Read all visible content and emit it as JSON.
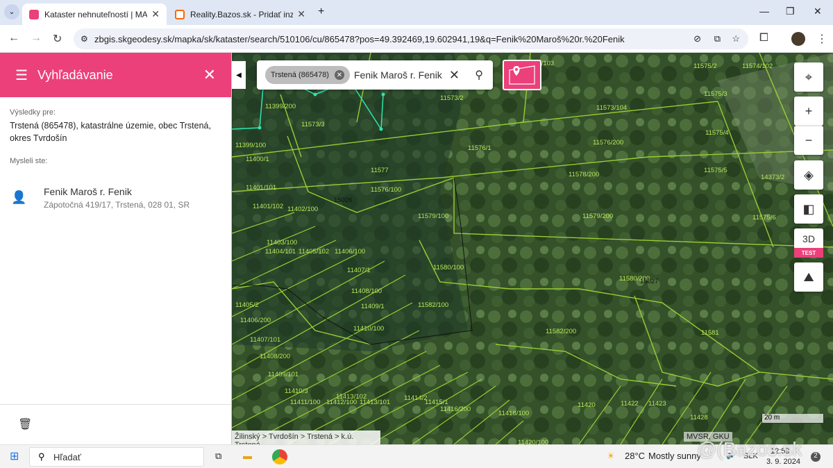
{
  "browser": {
    "tab1_title": "Kataster nehnuteľností | MAPKA",
    "tab2_title": "Reality.Bazos.sk - Pridať inzerát",
    "url": "zbgis.skgeodesy.sk/mapka/sk/kataster/search/510106/cu/865478?pos=49.392469,19.602941,19&q=Fenik%20Maroš%20r.%20Fenik"
  },
  "panel": {
    "title": "Vyhľadávanie",
    "results_for_label": "Výsledky pre:",
    "results_for_value": "Trstená (865478), katastrálne územie, obec Trstená, okres Tvrdošín",
    "did_you_mean_label": "Mysleli ste:",
    "person_name": "Fenik Maroš r. Fenik",
    "person_address": "Zápotočná 419/17, Trstená, 028 01, SR"
  },
  "search": {
    "chip": "Trstená (865478)",
    "query": "Fenik Maroš r. Fenik"
  },
  "map": {
    "control_3d": "3D",
    "badge": "TEST",
    "breadcrumb": "Žilinský > Tvrdošín > Trstená > k.ú. Trstená",
    "scale": "20 m",
    "attribution": "MVSR, GKU",
    "parcels": [
      "11573/103",
      "11575/2",
      "11574/102",
      "11399/200",
      "11573/3",
      "11573/2",
      "11573/104",
      "11575/3",
      "11399/100",
      "11400/1",
      "11576/1",
      "11575/4",
      "11576/200",
      "11577",
      "11576/100",
      "11578/200",
      "11575/5",
      "14373/2",
      "11401/101",
      "15026",
      "11401/102",
      "11402/100",
      "11579/100",
      "11579/200",
      "11575/6",
      "11403/100",
      "11404/101",
      "11405/102",
      "11406/100",
      "11580/100",
      "11580/200",
      "15027",
      "11407/1",
      "11408/100",
      "11405/2",
      "11409/1",
      "11582/100",
      "11406/200",
      "11410/100",
      "11582/200",
      "11581",
      "11407/101",
      "11408/200",
      "11409/101",
      "11410/3",
      "11413/102",
      "11414/2",
      "11411/100",
      "11412/100",
      "11413/101",
      "11415/1",
      "11416/200",
      "11418/100",
      "11420",
      "11422",
      "11423",
      "11428",
      "11420/100"
    ]
  },
  "taskbar": {
    "search_placeholder": "Hľadať",
    "weather": "28°C",
    "weather_desc": "Mostly sunny",
    "lang": "SLK",
    "time": "12:59",
    "date": "3. 9. 2024",
    "notif": "2",
    "watermark": "@(Bazos.sk"
  }
}
